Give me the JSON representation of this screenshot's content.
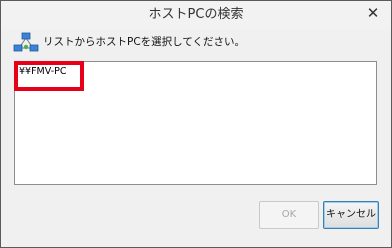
{
  "window": {
    "title": "ホストPCの検索",
    "close_glyph": "✕"
  },
  "dialog": {
    "icon": "network-computers-icon",
    "instruction": "リストからホストPCを選択してください。",
    "hosts": [
      "¥¥FMV-PC"
    ],
    "ok_label": "OK",
    "cancel_label": "キャンセル"
  },
  "colors": {
    "highlight": "#e8001a",
    "default_button_border": "#3c7fb1"
  }
}
